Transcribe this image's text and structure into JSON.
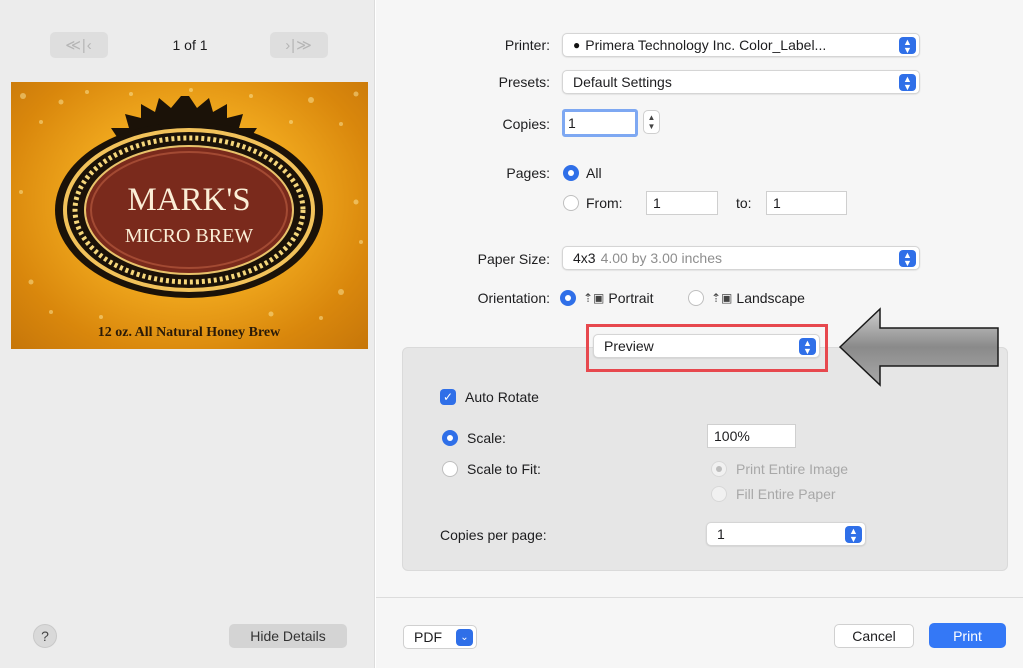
{
  "preview_nav": {
    "first_prev_glyph": "≪|‹",
    "next_last_glyph": "›|≫",
    "page_indicator": "1 of 1"
  },
  "label": {
    "line1": "MARK'S",
    "line2": "MICRO BREW",
    "tagline": "12 oz. All Natural Honey Brew"
  },
  "left_footer": {
    "help_glyph": "?",
    "hide_details_label": "Hide Details"
  },
  "printer": {
    "label": "Printer:",
    "value": "Primera Technology Inc. Color_Label...",
    "status_glyph": "●"
  },
  "presets": {
    "label": "Presets:",
    "value": "Default Settings"
  },
  "copies": {
    "label": "Copies:",
    "value": "1"
  },
  "pages": {
    "label": "Pages:",
    "all_label": "All",
    "from_label": "From:",
    "from_value": "1",
    "to_label": "to:",
    "to_value": "1"
  },
  "paper_size": {
    "label": "Paper Size:",
    "value": "4x3",
    "detail": "4.00 by 3.00 inches"
  },
  "orientation": {
    "label": "Orientation:",
    "portrait_label": "Portrait",
    "landscape_label": "Landscape"
  },
  "section_menu": {
    "value": "Preview"
  },
  "preview_options": {
    "auto_rotate_label": "Auto Rotate",
    "scale_label": "Scale:",
    "scale_value": "100%",
    "scale_to_fit_label": "Scale to Fit:",
    "print_entire_image_label": "Print Entire Image",
    "fill_entire_paper_label": "Fill Entire Paper",
    "copies_per_page_label": "Copies per page:",
    "copies_per_page_value": "1"
  },
  "footer": {
    "pdf_label": "PDF",
    "cancel_label": "Cancel",
    "print_label": "Print"
  },
  "colors": {
    "accent": "#3478f6",
    "highlight": "#e7484e",
    "label_background": "#eea51c",
    "label_oval": "#7a2a1c"
  }
}
